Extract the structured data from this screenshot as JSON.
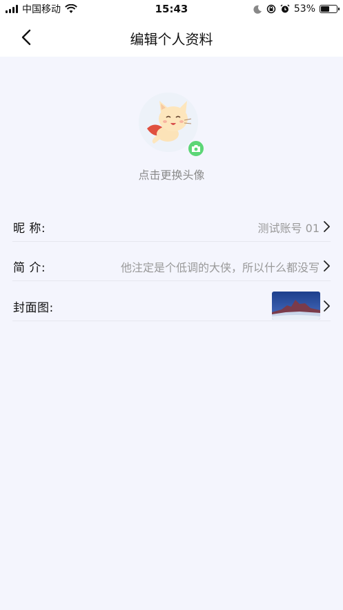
{
  "status_bar": {
    "carrier": "中国移动",
    "time": "15:43",
    "battery": "53%",
    "battery_level": 0.53,
    "icons": [
      "signal-icon",
      "wifi-icon",
      "moon-icon",
      "rotation-lock-icon",
      "alarm-icon",
      "battery-icon"
    ]
  },
  "nav": {
    "title": "编辑个人资料",
    "back_icon": "chevron-left-icon"
  },
  "avatar": {
    "change_text": "点击更换头像",
    "badge_icon": "camera-icon",
    "accent_color": "#5cd676"
  },
  "rows": [
    {
      "label": "昵  称:",
      "value": "测试账号 01"
    },
    {
      "label": "简  介:",
      "value": "他注定是个低调的大侠，所以什么都没写"
    },
    {
      "label": "封面图:",
      "value": ""
    }
  ],
  "colors": {
    "background": "#f4f5fd",
    "header": "#ffffff",
    "muted_text": "#999999"
  }
}
